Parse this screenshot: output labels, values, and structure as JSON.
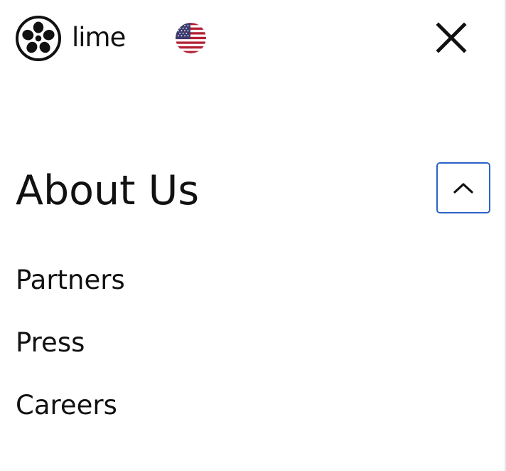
{
  "header": {
    "brand": "Lime",
    "logo_text": "lime",
    "region_flag": "us-flag-icon",
    "close_icon": "close-icon"
  },
  "section": {
    "title": "About Us",
    "toggle_icon": "chevron-up-icon",
    "expanded": true,
    "items": [
      {
        "label": "Partners"
      },
      {
        "label": "Press"
      },
      {
        "label": "Careers"
      }
    ]
  },
  "colors": {
    "text": "#111111",
    "background": "#ffffff",
    "focus_border": "#2b62c6",
    "flag_red": "#b22234",
    "flag_blue": "#3c3b6e"
  }
}
